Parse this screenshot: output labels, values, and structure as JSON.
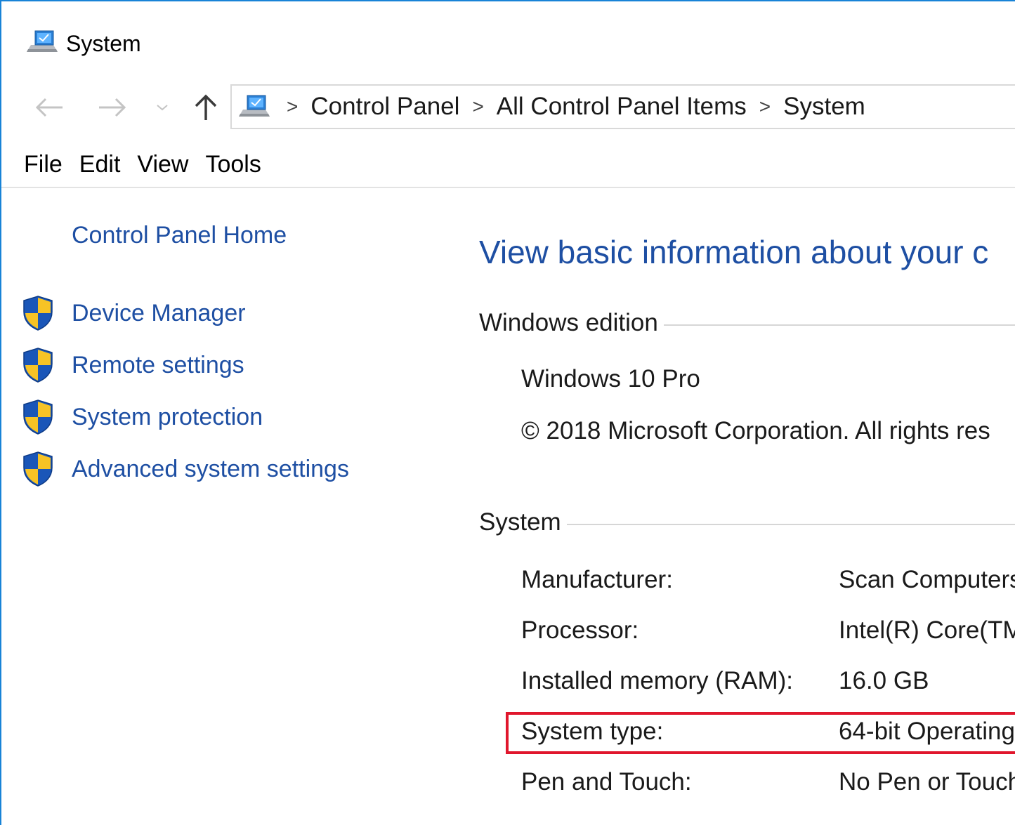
{
  "window": {
    "title": "System",
    "icon": "system-computer-icon"
  },
  "nav": {
    "back_icon": "arrow-left-icon",
    "forward_icon": "arrow-right-icon",
    "recent_icon": "chevron-down-icon",
    "up_icon": "arrow-up-icon",
    "breadcrumb": [
      "Control Panel",
      "All Control Panel Items",
      "System"
    ],
    "breadcrumb_separator": ">"
  },
  "menu": {
    "items": [
      "File",
      "Edit",
      "View",
      "Tools"
    ]
  },
  "sidebar": {
    "home_link": "Control Panel Home",
    "tasks": [
      {
        "label": "Device Manager",
        "icon": "uac-shield-icon"
      },
      {
        "label": "Remote settings",
        "icon": "uac-shield-icon"
      },
      {
        "label": "System protection",
        "icon": "uac-shield-icon"
      },
      {
        "label": "Advanced system settings",
        "icon": "uac-shield-icon"
      }
    ]
  },
  "main": {
    "title": "View basic information about your c",
    "windows_edition": {
      "heading": "Windows edition",
      "edition": "Windows 10 Pro",
      "copyright": "© 2018 Microsoft Corporation. All rights res"
    },
    "system": {
      "heading": "System",
      "rows": [
        {
          "label": "Manufacturer:",
          "value": "Scan Computers"
        },
        {
          "label": "Processor:",
          "value": "Intel(R) Core(TM"
        },
        {
          "label": "Installed memory (RAM):",
          "value": "16.0 GB"
        },
        {
          "label": "System type:",
          "value": "64-bit Operating"
        },
        {
          "label": "Pen and Touch:",
          "value": "No Pen or Touch"
        }
      ],
      "highlighted_row": "System type:"
    }
  },
  "colors": {
    "link": "#1e4fa3",
    "window_border": "#1883d7",
    "highlight_border": "#e0162c"
  }
}
